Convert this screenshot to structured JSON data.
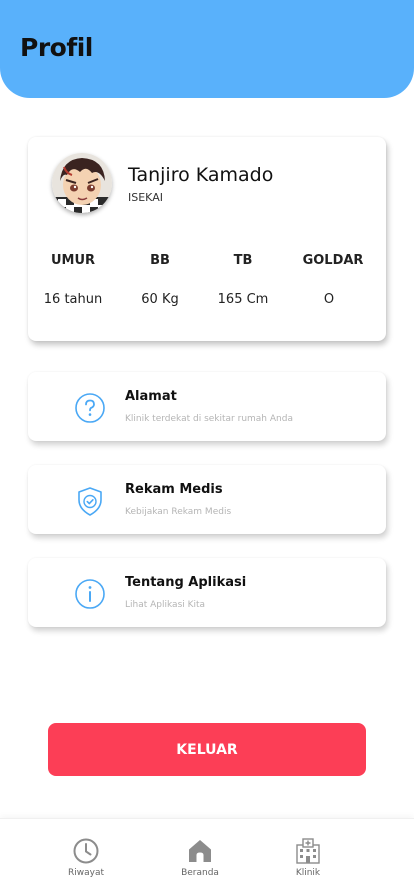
{
  "header": {
    "title": "Profil"
  },
  "profile": {
    "name": "Tanjiro Kamado",
    "subtitle": "ISEKAI",
    "stats": [
      {
        "label": "UMUR",
        "value": "16 tahun"
      },
      {
        "label": "BB",
        "value": "60 Kg"
      },
      {
        "label": "TB",
        "value": "165 Cm"
      },
      {
        "label": "GOLDAR",
        "value": "O"
      }
    ]
  },
  "menu": [
    {
      "title": "Alamat",
      "subtitle": "Klinik terdekat di sekitar rumah Anda",
      "icon": "question-circle-icon"
    },
    {
      "title": "Rekam Medis",
      "subtitle": "Kebijakan Rekam Medis",
      "icon": "shield-check-icon"
    },
    {
      "title": "Tentang Aplikasi",
      "subtitle": "Lihat Aplikasi Kita",
      "icon": "info-circle-icon"
    }
  ],
  "logout_label": "KELUAR",
  "bottom_nav": [
    {
      "label": "Riwayat",
      "icon": "clock-icon"
    },
    {
      "label": "Beranda",
      "icon": "home-icon"
    },
    {
      "label": "Klinik",
      "icon": "hospital-icon"
    }
  ],
  "colors": {
    "header": "#59b1fb",
    "accent_icon": "#4aa8f5",
    "logout": "#fc3e56"
  }
}
